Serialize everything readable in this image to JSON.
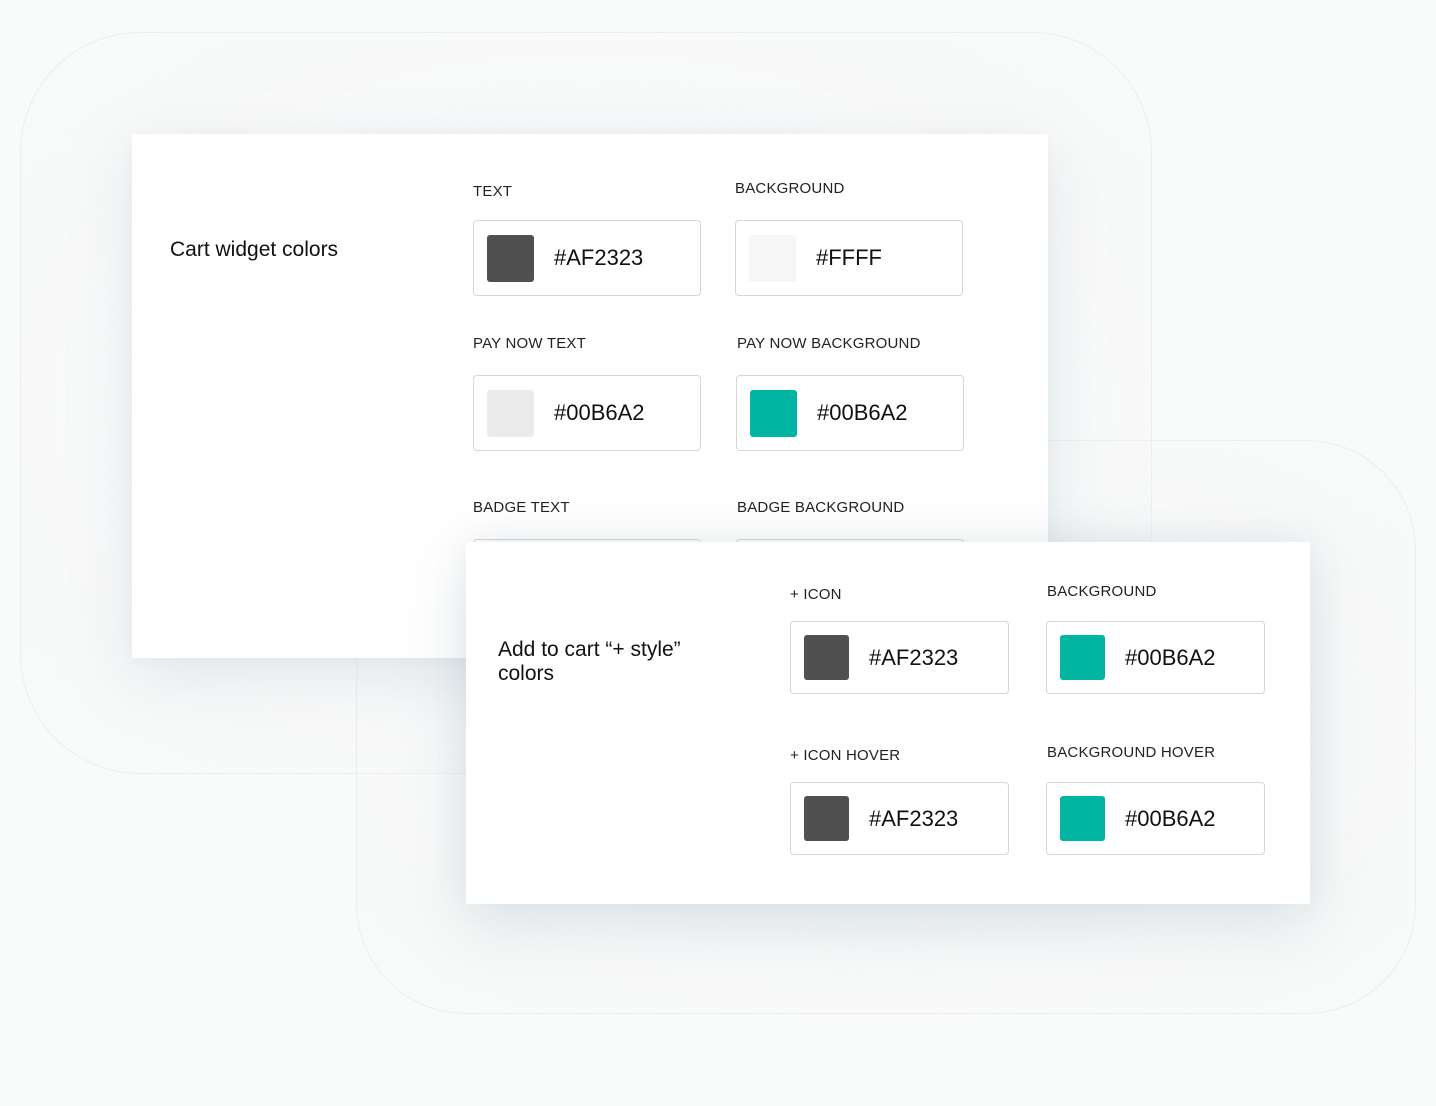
{
  "colors": {
    "dark_gray": "#505050",
    "very_light_gray": "#f6f6f6",
    "light_gray": "#ebebeb",
    "teal": "#00b6a2"
  },
  "cart_widget": {
    "title": "Cart widget colors",
    "fields": [
      {
        "label": "TEXT",
        "value": "#AF2323",
        "swatch": "#505050"
      },
      {
        "label": "BACKGROUND",
        "value": "#FFFF",
        "swatch": "#f6f6f6"
      },
      {
        "label": "PAY NOW TEXT",
        "value": "#00B6A2",
        "swatch": "#ebebeb"
      },
      {
        "label": "PAY NOW BACKGROUND",
        "value": "#00B6A2",
        "swatch": "#00b6a2"
      },
      {
        "label": "BADGE TEXT"
      },
      {
        "label": "BADGE BACKGROUND"
      }
    ]
  },
  "add_to_cart": {
    "title": "Add to cart “+ style” colors",
    "fields": [
      {
        "label": "+ ICON",
        "value": "#AF2323",
        "swatch": "#505050"
      },
      {
        "label": "BACKGROUND",
        "value": "#00B6A2",
        "swatch": "#00b6a2"
      },
      {
        "label": "+ ICON HOVER",
        "value": "#AF2323",
        "swatch": "#505050"
      },
      {
        "label": "BACKGROUND HOVER",
        "value": "#00B6A2",
        "swatch": "#00b6a2"
      }
    ]
  }
}
